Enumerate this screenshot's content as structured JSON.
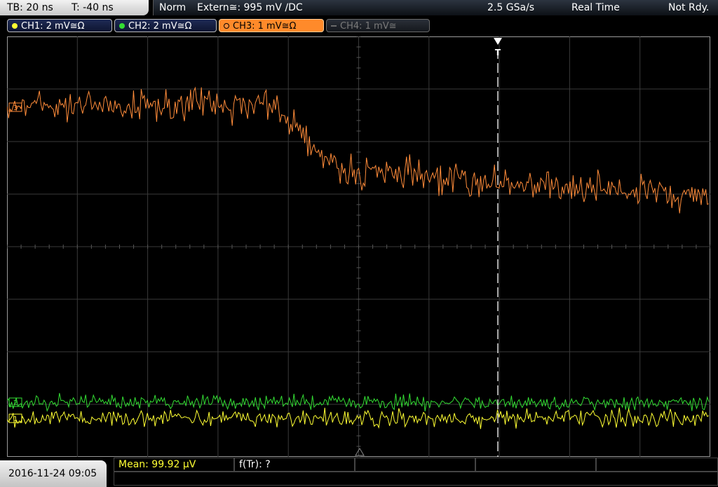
{
  "header": {
    "timebase": "TB: 20 ns",
    "trigger_time": "T: -40 ns",
    "acq_mode": "Norm",
    "trigger_source": "Extern≅: 995 mV ∕DC",
    "sample_rate": "2.5 GSa/s",
    "sampling_mode": "Real Time",
    "trigger_status": "Not Rdy."
  },
  "channels": [
    {
      "label": "CH1: 2 mV≅Ω",
      "color": "#ffff33"
    },
    {
      "label": "CH2: 2 mV≅Ω",
      "color": "#33dd33"
    },
    {
      "label": "CH3: 1 mV≅Ω",
      "color": "#ff8c3a"
    },
    {
      "label": "CH4: 1 mV≅",
      "color": "#6a6a6a"
    }
  ],
  "screen": {
    "ch_markers": [
      "3",
      "2",
      "1"
    ],
    "trigger_label": "T"
  },
  "footer": {
    "datetime": "2016-11-24 09:05",
    "measurements": [
      {
        "label": "Mean: 99.92 µV",
        "color": "#ffff33"
      },
      {
        "label": "f(Tr): ?",
        "color": "#ffffff"
      },
      {
        "label": "",
        "color": "#ffffff"
      },
      {
        "label": "",
        "color": "#ffffff"
      },
      {
        "label": "",
        "color": "#ffffff"
      },
      {
        "label": "",
        "color": "#ffffff"
      }
    ]
  }
}
